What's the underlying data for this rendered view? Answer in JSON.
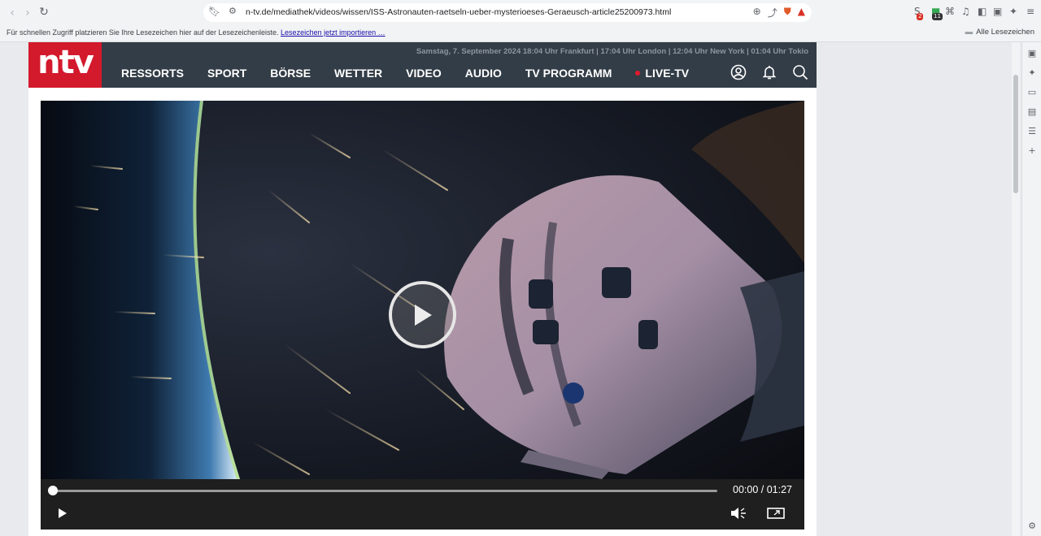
{
  "browser": {
    "url": "n-tv.de/mediathek/videos/wissen/ISS-Astronauten-raetseln-ueber-mysterioeses-Geraeusch-article25200973.html",
    "bookmark_bar_message": "Für schnellen Zugriff platzieren Sie Ihre Lesezeichen hier auf der Lesezeichenleiste.",
    "bookmark_bar_link": "Lesezeichen jetzt importieren …",
    "all_bookmarks": "Alle Lesezeichen",
    "extension_badges": [
      "2",
      "11"
    ]
  },
  "site": {
    "logo_text": "ntv",
    "dateline": "Samstag, 7. September 2024 18:04 Uhr Frankfurt | 17:04 Uhr London | 12:04 Uhr New York | 01:04 Uhr Tokio",
    "nav": [
      {
        "label": "RESSORTS"
      },
      {
        "label": "SPORT"
      },
      {
        "label": "BÖRSE"
      },
      {
        "label": "WETTER"
      },
      {
        "label": "VIDEO"
      },
      {
        "label": "AUDIO"
      },
      {
        "label": "TV PROGRAMM"
      },
      {
        "label": "LIVE-TV"
      }
    ],
    "colors": {
      "brand_red": "#d3192c",
      "header_bg": "#333d47",
      "live_dot": "#e0192d"
    }
  },
  "player": {
    "current_time": "00:00",
    "duration": "01:27",
    "time_display": "00:00 / 01:27",
    "progress_fraction": 0.0,
    "muted": true
  }
}
